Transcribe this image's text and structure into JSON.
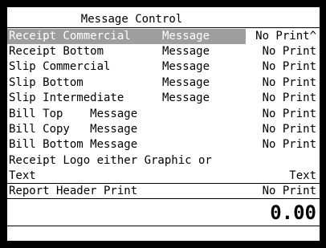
{
  "window": {
    "title": "Message Control"
  },
  "rows": [
    {
      "label": "Receipt Commercial",
      "middle": "Message",
      "value": "No Print^"
    },
    {
      "label": "Receipt Bottom",
      "middle": "Message",
      "value": "No Print"
    },
    {
      "label": "Slip Commercial",
      "middle": "Message",
      "value": "No Print"
    },
    {
      "label": "Slip Bottom",
      "middle": "Message",
      "value": "No Print"
    },
    {
      "label": "Slip Intermediate",
      "middle": "Message",
      "value": "No Print"
    },
    {
      "label": "Bill Top    Message",
      "middle": "",
      "value": "No Print"
    },
    {
      "label": "Bill Copy   Message",
      "middle": "",
      "value": "No Print"
    },
    {
      "label": "Bill Bottom Message",
      "middle": "",
      "value": "No Print"
    },
    {
      "label": "Receipt Logo either Graphic or",
      "middle": "",
      "value": ""
    },
    {
      "label": "Text",
      "middle": "",
      "value": "Text"
    },
    {
      "label": "Report Header Print",
      "middle": "",
      "value": "No Print"
    }
  ],
  "amount": "0.00",
  "colors": {
    "selection": "#9e9e9e",
    "background": "#ffffff",
    "frame": "#000000"
  }
}
